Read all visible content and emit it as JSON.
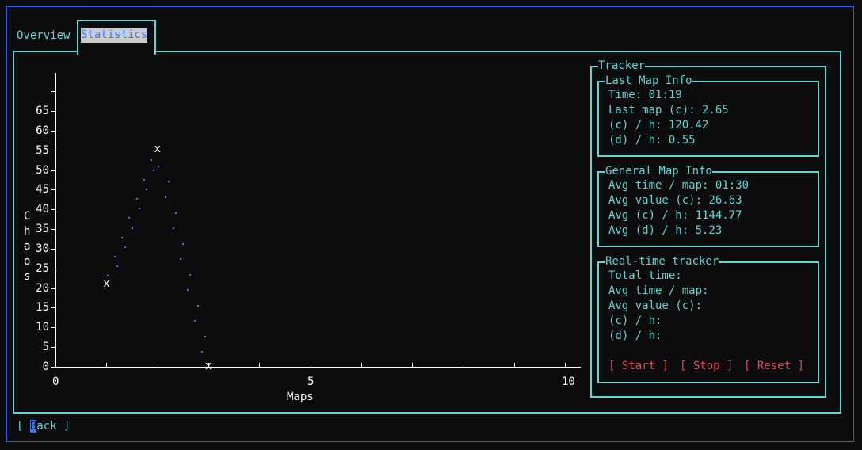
{
  "tabs": [
    {
      "label": "Overview",
      "active": false
    },
    {
      "label": "Statistics",
      "active": true
    }
  ],
  "chart_data": {
    "type": "scatter",
    "xlabel": "Maps",
    "ylabel": "Chaos",
    "xlim": [
      0,
      10
    ],
    "ylim": [
      0,
      65
    ],
    "x_ticks": [
      "0",
      "5",
      "10"
    ],
    "y_ticks": [
      "0",
      "5",
      "10",
      "15",
      "20",
      "25",
      "30",
      "35",
      "40",
      "45",
      "50",
      "55",
      "60",
      "65"
    ],
    "points": [
      {
        "x": 1,
        "y": 20.83
      },
      {
        "x": 2,
        "y": 55.07
      },
      {
        "x": 3,
        "y": 0.0
      }
    ],
    "marker": "x",
    "line_style": "dotted",
    "colors": {
      "points": "#ffffff",
      "line": "#3b78ff",
      "axes": "#ffffff"
    }
  },
  "tracker": {
    "title": "Tracker",
    "last_map": {
      "title": "Last Map Info",
      "lines": [
        "Time: 01:19",
        "Last map (c): 2.65",
        "(c) / h: 120.42",
        "(d) / h: 0.55"
      ]
    },
    "general": {
      "title": "General Map Info",
      "lines": [
        "Avg time / map: 01:30",
        "Avg value (c): 26.63",
        "Avg (c) / h: 1144.77",
        "Avg (d) / h: 5.23"
      ]
    },
    "realtime": {
      "title": "Real-time tracker",
      "lines": [
        "Total time:",
        "Avg time / map:",
        "Avg value (c):",
        "(c) / h:",
        "(d) / h:"
      ],
      "buttons": [
        {
          "open": "[ ",
          "key": "S",
          "rest": "tart",
          "close": " ]"
        },
        {
          "open": "[ ",
          "key": "S",
          "rest": "top",
          "close": " ]"
        },
        {
          "open": "[ ",
          "key": "R",
          "rest": "eset",
          "close": " ]"
        }
      ]
    }
  },
  "footer": {
    "back_open": "[ ",
    "back_key": "B",
    "back_rest": "ack",
    "back_close": " ]"
  },
  "colors": {
    "frame": "#61d6d6",
    "border": "#2a5cf5",
    "accent": "#3b78ff",
    "danger": "#e74856"
  }
}
